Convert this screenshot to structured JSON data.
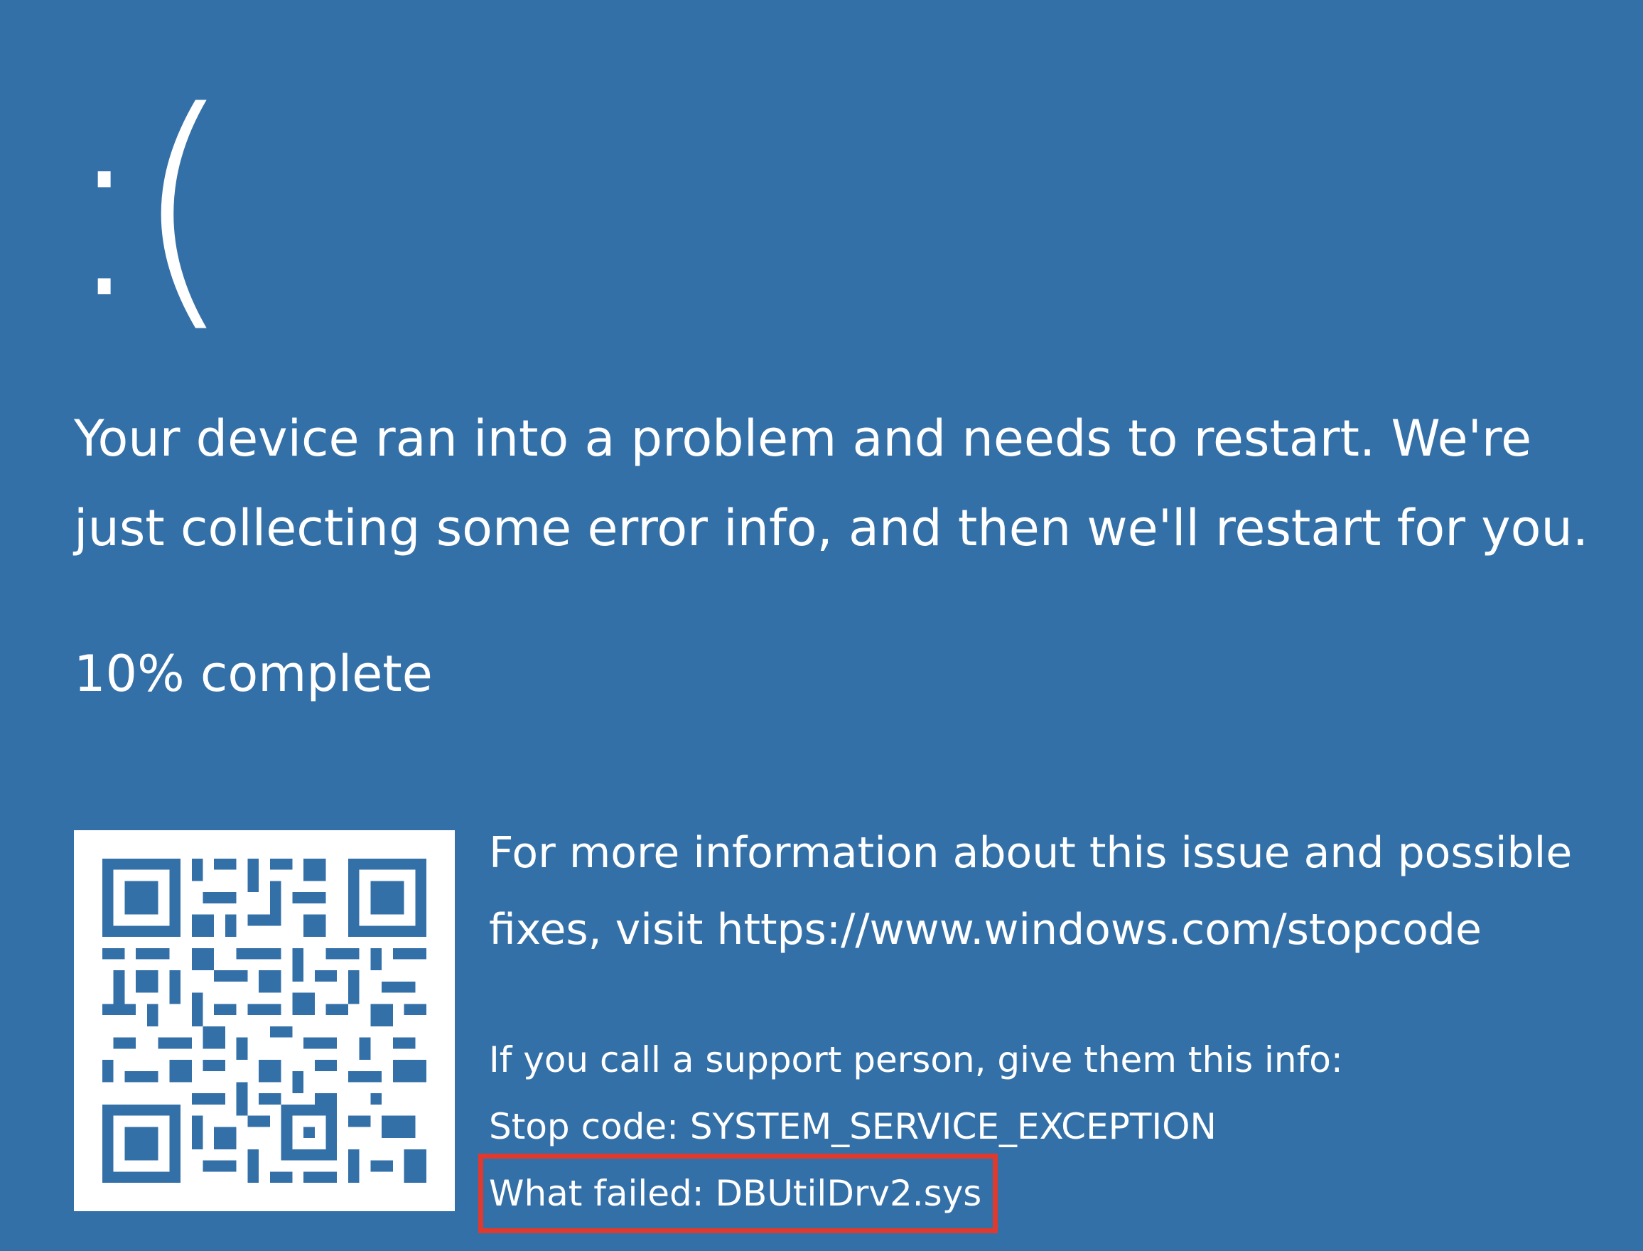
{
  "bsod": {
    "face": ":(",
    "message": "Your device ran into a problem and needs to restart. We're just collecting some error info, and then we'll restart for you.",
    "progress_text": "10% complete",
    "progress_percent": 10,
    "more_info": "For more information about this issue and possible fixes, visit https://www.windows.com/stopcode",
    "support_intro": "If you call a support person, give them this info:",
    "stop_code": "Stop code: SYSTEM_SERVICE_EXCEPTION",
    "what_failed": "What failed: DBUtilDrv2.sys"
  },
  "colors": {
    "background": "#3470a8",
    "text": "#ffffff",
    "highlight_border": "#e03a2e"
  },
  "icons": {
    "qr": "qr-code-icon"
  }
}
